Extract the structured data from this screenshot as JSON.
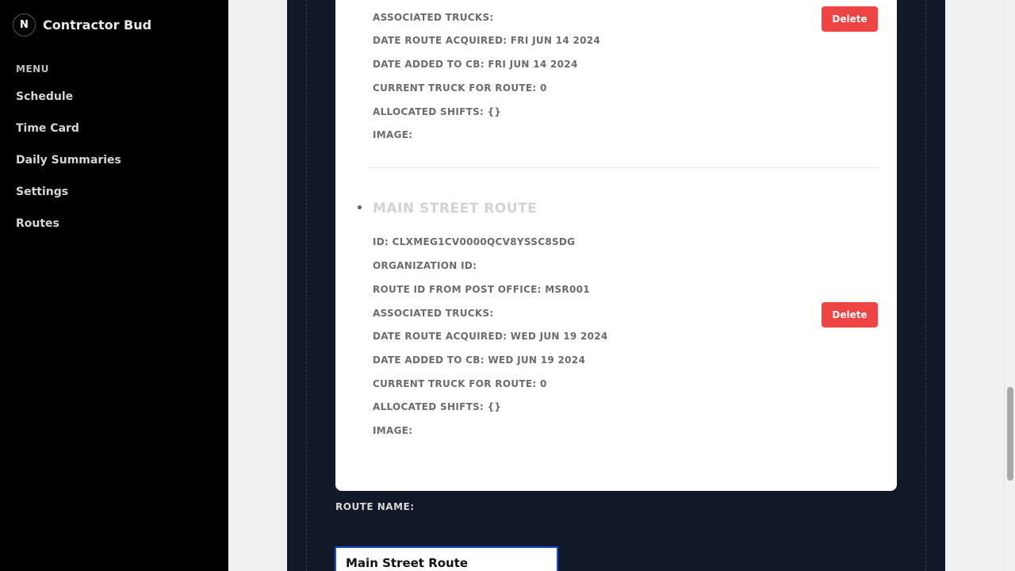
{
  "app": {
    "name": "Contractor Bud",
    "logo_letter": "N"
  },
  "sidebar": {
    "menu_title": "MENU",
    "items": [
      {
        "label": "Schedule"
      },
      {
        "label": "Time Card"
      },
      {
        "label": "Daily Summaries"
      },
      {
        "label": "Settings"
      },
      {
        "label": "Routes"
      }
    ]
  },
  "routes": [
    {
      "fields": {
        "associated_trucks": "ASSOCIATED TRUCKS:",
        "date_acquired": "DATE ROUTE ACQUIRED: FRI JUN 14 2024",
        "date_added": "DATE ADDED TO CB: FRI JUN 14 2024",
        "current_truck": "CURRENT TRUCK FOR ROUTE: 0",
        "allocated_shifts": "ALLOCATED SHIFTS: {}",
        "image": "IMAGE:"
      },
      "delete_label": "Delete"
    },
    {
      "title": "MAIN STREET ROUTE",
      "fields": {
        "id": "ID: CLXMEG1CV0000QCV8YSSC8SDG",
        "organization_id": "ORGANIZATION ID:",
        "post_office_id": "ROUTE ID FROM POST OFFICE: MSR001",
        "associated_trucks": "ASSOCIATED TRUCKS:",
        "date_acquired": "DATE ROUTE ACQUIRED: WED JUN 19 2024",
        "date_added": "DATE ADDED TO CB: WED JUN 19 2024",
        "current_truck": "CURRENT TRUCK FOR ROUTE: 0",
        "allocated_shifts": "ALLOCATED SHIFTS: {}",
        "image": "IMAGE:"
      },
      "delete_label": "Delete"
    }
  ],
  "form": {
    "route_name_label": "ROUTE NAME:",
    "route_name_value": "Main Street Route"
  },
  "colors": {
    "sidebar_bg": "#000000",
    "panel_bg": "#111827",
    "delete_red": "#ef4444",
    "input_border": "#1d4ed8"
  }
}
